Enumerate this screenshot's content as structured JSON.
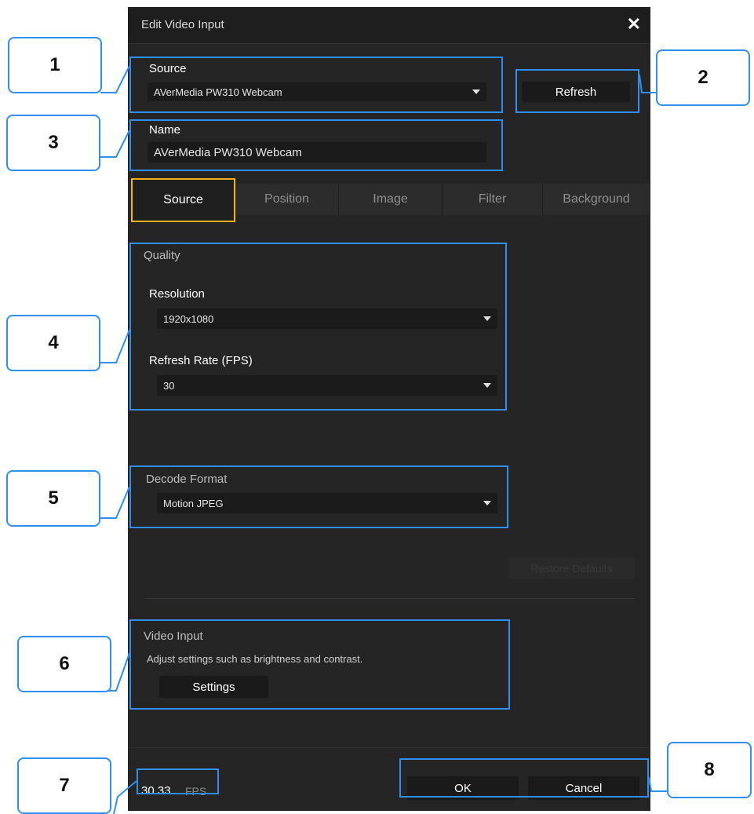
{
  "dialog": {
    "title": "Edit Video Input",
    "close_glyph": "✕"
  },
  "source_field": {
    "label": "Source",
    "value": "AVerMedia PW310 Webcam"
  },
  "refresh_button": "Refresh",
  "name_field": {
    "label": "Name",
    "value": "AVerMedia PW310 Webcam"
  },
  "tabs": [
    {
      "label": "Source",
      "active": true
    },
    {
      "label": "Position",
      "active": false
    },
    {
      "label": "Image",
      "active": false
    },
    {
      "label": "Filter",
      "active": false
    },
    {
      "label": "Background",
      "active": false
    }
  ],
  "quality": {
    "heading": "Quality",
    "resolution_label": "Resolution",
    "resolution_value": "1920x1080",
    "fps_label": "Refresh Rate (FPS)",
    "fps_value": "30"
  },
  "decode": {
    "heading": "Decode Format",
    "value": "Motion JPEG"
  },
  "restore_button": "Restore Defaults",
  "video_input": {
    "heading": "Video Input",
    "description": "Adjust settings such as brightness and contrast.",
    "settings_button": "Settings"
  },
  "footer": {
    "fps_value": "30.33",
    "fps_unit": "FPS",
    "ok_button": "OK",
    "cancel_button": "Cancel"
  },
  "callouts": [
    "1",
    "2",
    "3",
    "4",
    "5",
    "6",
    "7",
    "8"
  ],
  "colors": {
    "dialog_bg": "#252525",
    "highlight": "#2f8ff0",
    "active_tab_border": "#f3b21c"
  }
}
